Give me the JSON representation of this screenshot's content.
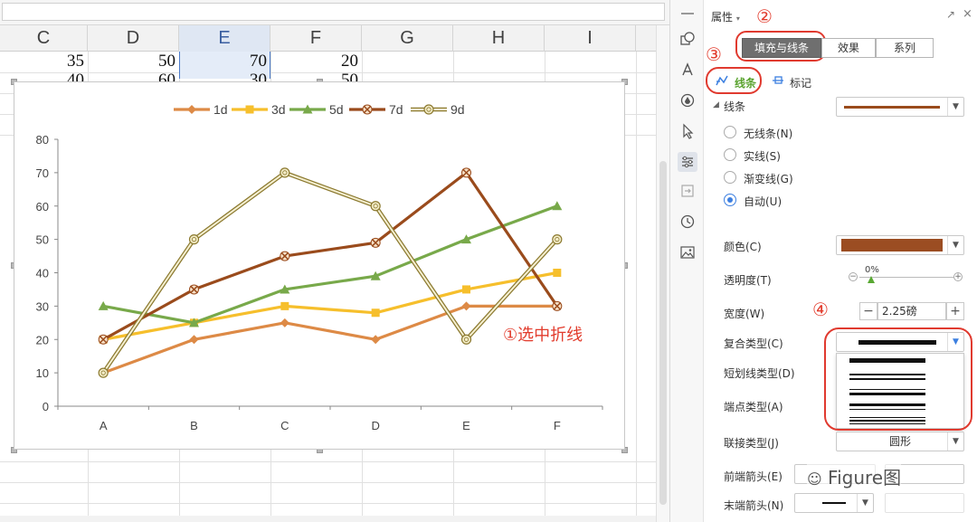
{
  "sheet": {
    "columns": [
      "C",
      "D",
      "E",
      "F",
      "G",
      "H",
      "I"
    ],
    "selected_column": "E",
    "row1": [
      "35",
      "50",
      "70",
      "20"
    ],
    "row2": [
      "40",
      "60",
      "30",
      "50"
    ]
  },
  "chart_data": {
    "type": "line",
    "categories": [
      "A",
      "B",
      "C",
      "D",
      "E",
      "F"
    ],
    "series": [
      {
        "name": "1d",
        "color": "#dd8a46",
        "values": [
          10,
          20,
          25,
          20,
          30,
          30
        ]
      },
      {
        "name": "3d",
        "color": "#f6bf2c",
        "values": [
          20,
          25,
          30,
          28,
          35,
          40
        ]
      },
      {
        "name": "5d",
        "color": "#78a94a",
        "values": [
          30,
          25,
          35,
          39,
          50,
          60
        ]
      },
      {
        "name": "7d",
        "color": "#9a4b1c",
        "values": [
          20,
          35,
          45,
          49,
          70,
          30
        ]
      },
      {
        "name": "9d",
        "color": "#c9b463",
        "values": [
          10,
          50,
          70,
          60,
          20,
          50
        ]
      }
    ],
    "ylim": [
      0,
      80
    ],
    "yticks": [
      "0",
      "10",
      "20",
      "30",
      "40",
      "50",
      "60",
      "70",
      "80"
    ],
    "legend": "top",
    "grid": false,
    "annotation": "①选中折线"
  },
  "panel": {
    "title": "属性",
    "tabs": [
      "填充与线条",
      "效果",
      "系列"
    ],
    "subtabs": [
      "线条",
      "标记"
    ],
    "section": "线条",
    "radio_options": [
      "无线条(N)",
      "实线(S)",
      "渐变线(G)",
      "自动(U)"
    ],
    "selected_radio": "自动(U)",
    "color_label": "颜色(C)",
    "line_color": "#9a4b1c",
    "color_swatch": "#9b4d22",
    "transparency_label": "透明度(T)",
    "transparency_value": "0%",
    "width_label": "宽度(W)",
    "width_value": "2.25磅",
    "compound_label": "复合类型(C)",
    "dash_label": "短划线类型(D)",
    "cap_label": "端点类型(A)",
    "join_label": "联接类型(J)",
    "join_value": "圆形",
    "begin_arrow_label": "前端箭头(E)",
    "end_arrow_label": "末端箭头(N)",
    "step_minus": "−",
    "step_plus": "+",
    "markers": {
      "m2": "②",
      "m3": "③",
      "m4": "④"
    },
    "watermark": "Figure图"
  }
}
